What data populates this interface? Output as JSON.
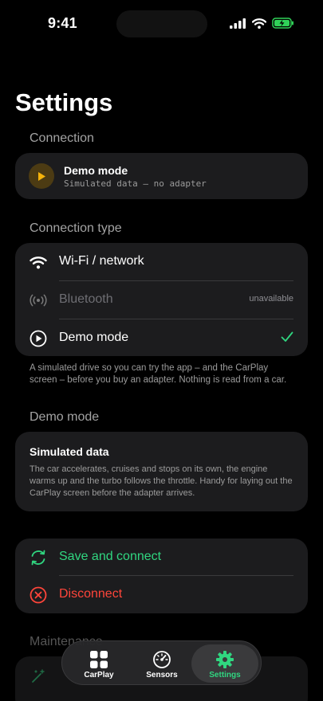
{
  "status": {
    "time": "9:41"
  },
  "page": {
    "title": "Settings"
  },
  "connection": {
    "section_label": "Connection",
    "status_title": "Demo mode",
    "status_subtitle": "Simulated data — no adapter"
  },
  "connection_type": {
    "section_label": "Connection type",
    "options": [
      {
        "label": "Wi-Fi / network",
        "icon": "wifi-icon"
      },
      {
        "label": "Bluetooth",
        "icon": "bluetooth-icon",
        "trailing": "unavailable"
      },
      {
        "label": "Demo mode",
        "icon": "play-circle-icon",
        "selected": true
      }
    ],
    "footnote": "A simulated drive so you can try the app – and the CarPlay screen – before you buy an adapter. Nothing is read from a car."
  },
  "demo_mode": {
    "section_label": "Demo mode",
    "card_title": "Simulated data",
    "card_body": "The car accelerates, cruises and stops on its own, the engine warms up and the turbo follows the throttle. Handy for laying out the CarPlay screen before the adapter arrives."
  },
  "actions": {
    "save_label": "Save and connect",
    "disconnect_label": "Disconnect"
  },
  "maintenance": {
    "section_label": "Maintenance"
  },
  "tab_bar": {
    "tabs": [
      {
        "label": "CarPlay",
        "icon": "grid-icon"
      },
      {
        "label": "Sensors",
        "icon": "gauge-icon"
      },
      {
        "label": "Settings",
        "icon": "gear-icon",
        "active": true
      }
    ]
  },
  "colors": {
    "background": "#000000",
    "card": "#1c1c1e",
    "accent_green": "#30d680",
    "destructive_red": "#ff453a",
    "demo_amber": "#f5b30b",
    "secondary_text": "#9b9b9b"
  }
}
